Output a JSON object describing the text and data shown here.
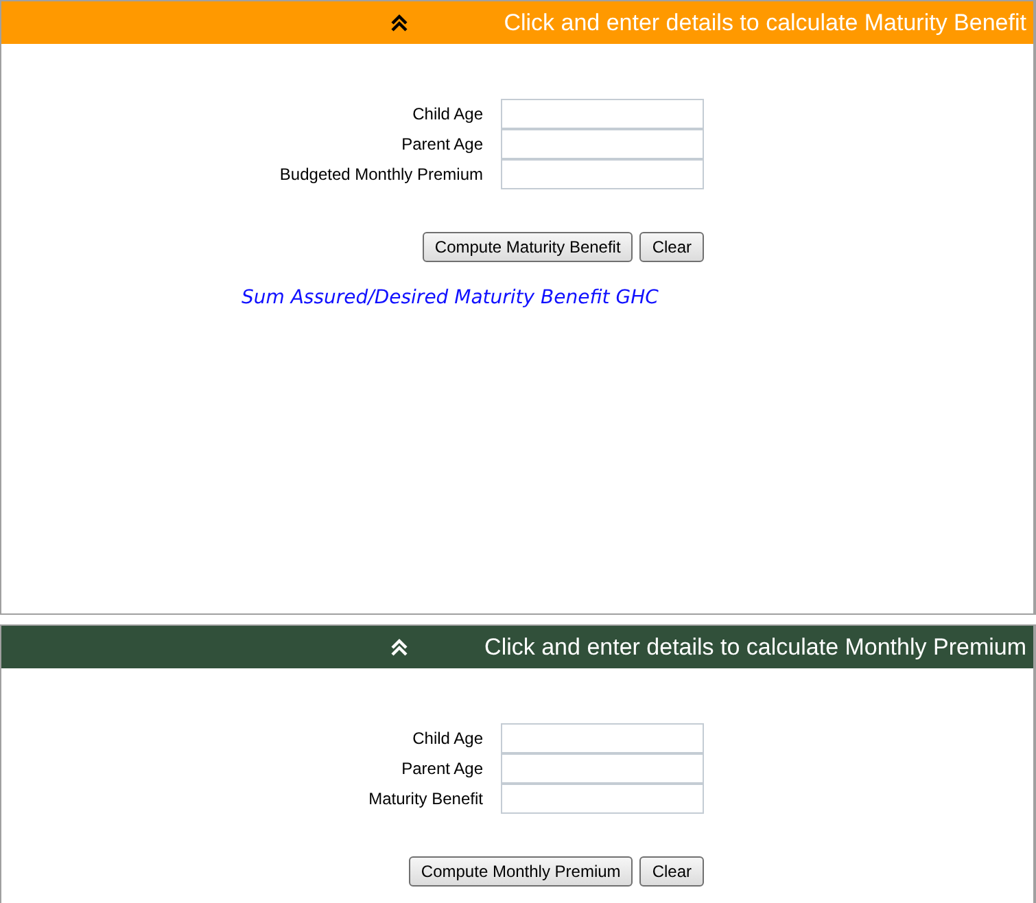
{
  "panels": [
    {
      "header": "Click and enter details to calculate Maturity Benefit",
      "color": "#ff9900",
      "fields": [
        {
          "label": "Child Age"
        },
        {
          "label": "Parent Age"
        },
        {
          "label": "Budgeted Monthly Premium"
        }
      ],
      "buttons": [
        "Compute Maturity Benefit",
        "Clear"
      ],
      "result": "Sum Assured/Desired Maturity Benefit GHC"
    },
    {
      "header": "Click and enter details to calculate Monthly Premium",
      "color": "#31503a",
      "fields": [
        {
          "label": "Child Age"
        },
        {
          "label": "Parent Age"
        },
        {
          "label": "Maturity Benefit"
        }
      ],
      "buttons": [
        "Compute Monthly Premium",
        "Clear"
      ]
    }
  ]
}
